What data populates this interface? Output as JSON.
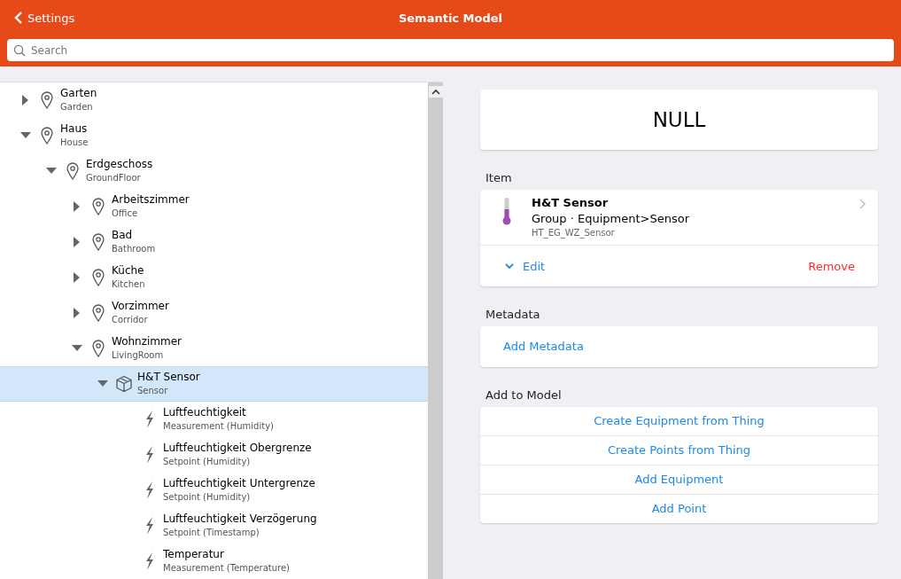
{
  "navbar": {
    "back_label": "Settings",
    "title": "Semantic Model"
  },
  "search": {
    "placeholder": "Search"
  },
  "tree": [
    {
      "kind": "location",
      "label": "Garten",
      "sublabel": "Garden",
      "expanded": false,
      "selected": false
    },
    {
      "kind": "location",
      "label": "Haus",
      "sublabel": "House",
      "expanded": true,
      "selected": false,
      "children": [
        {
          "kind": "location",
          "label": "Erdgeschoss",
          "sublabel": "GroundFloor",
          "expanded": true,
          "selected": false,
          "children": [
            {
              "kind": "location",
              "label": "Arbeitszimmer",
              "sublabel": "Office",
              "expanded": false,
              "selected": false
            },
            {
              "kind": "location",
              "label": "Bad",
              "sublabel": "Bathroom",
              "expanded": false,
              "selected": false
            },
            {
              "kind": "location",
              "label": "Küche",
              "sublabel": "Kitchen",
              "expanded": false,
              "selected": false
            },
            {
              "kind": "location",
              "label": "Vorzimmer",
              "sublabel": "Corridor",
              "expanded": false,
              "selected": false
            },
            {
              "kind": "location",
              "label": "Wohnzimmer",
              "sublabel": "LivingRoom",
              "expanded": true,
              "selected": false,
              "children": [
                {
                  "kind": "equipment",
                  "label": "H&T Sensor",
                  "sublabel": "Sensor",
                  "expanded": true,
                  "selected": true,
                  "children": [
                    {
                      "kind": "point",
                      "label": "Luftfeuchtigkeit",
                      "sublabel": "Measurement (Humidity)",
                      "selected": false
                    },
                    {
                      "kind": "point",
                      "label": "Luftfeuchtigkeit Obergrenze",
                      "sublabel": "Setpoint (Humidity)",
                      "selected": false
                    },
                    {
                      "kind": "point",
                      "label": "Luftfeuchtigkeit Untergrenze",
                      "sublabel": "Setpoint (Humidity)",
                      "selected": false
                    },
                    {
                      "kind": "point",
                      "label": "Luftfeuchtigkeit Verzögerung",
                      "sublabel": "Setpoint (Timestamp)",
                      "selected": false
                    },
                    {
                      "kind": "point",
                      "label": "Temperatur",
                      "sublabel": "Measurement (Temperature)",
                      "selected": false
                    }
                  ]
                }
              ]
            }
          ]
        }
      ]
    }
  ],
  "state_card": {
    "value": "NULL"
  },
  "item_section": {
    "heading": "Item",
    "name": "H&T Sensor",
    "type": "Group · Equipment>Sensor",
    "id": "HT_EG_WZ_Sensor",
    "edit_label": "Edit",
    "remove_label": "Remove"
  },
  "metadata_section": {
    "heading": "Metadata",
    "add_label": "Add Metadata"
  },
  "model_section": {
    "heading": "Add to Model",
    "actions": [
      "Create Equipment from Thing",
      "Create Points from Thing",
      "Add Equipment",
      "Add Point"
    ]
  }
}
